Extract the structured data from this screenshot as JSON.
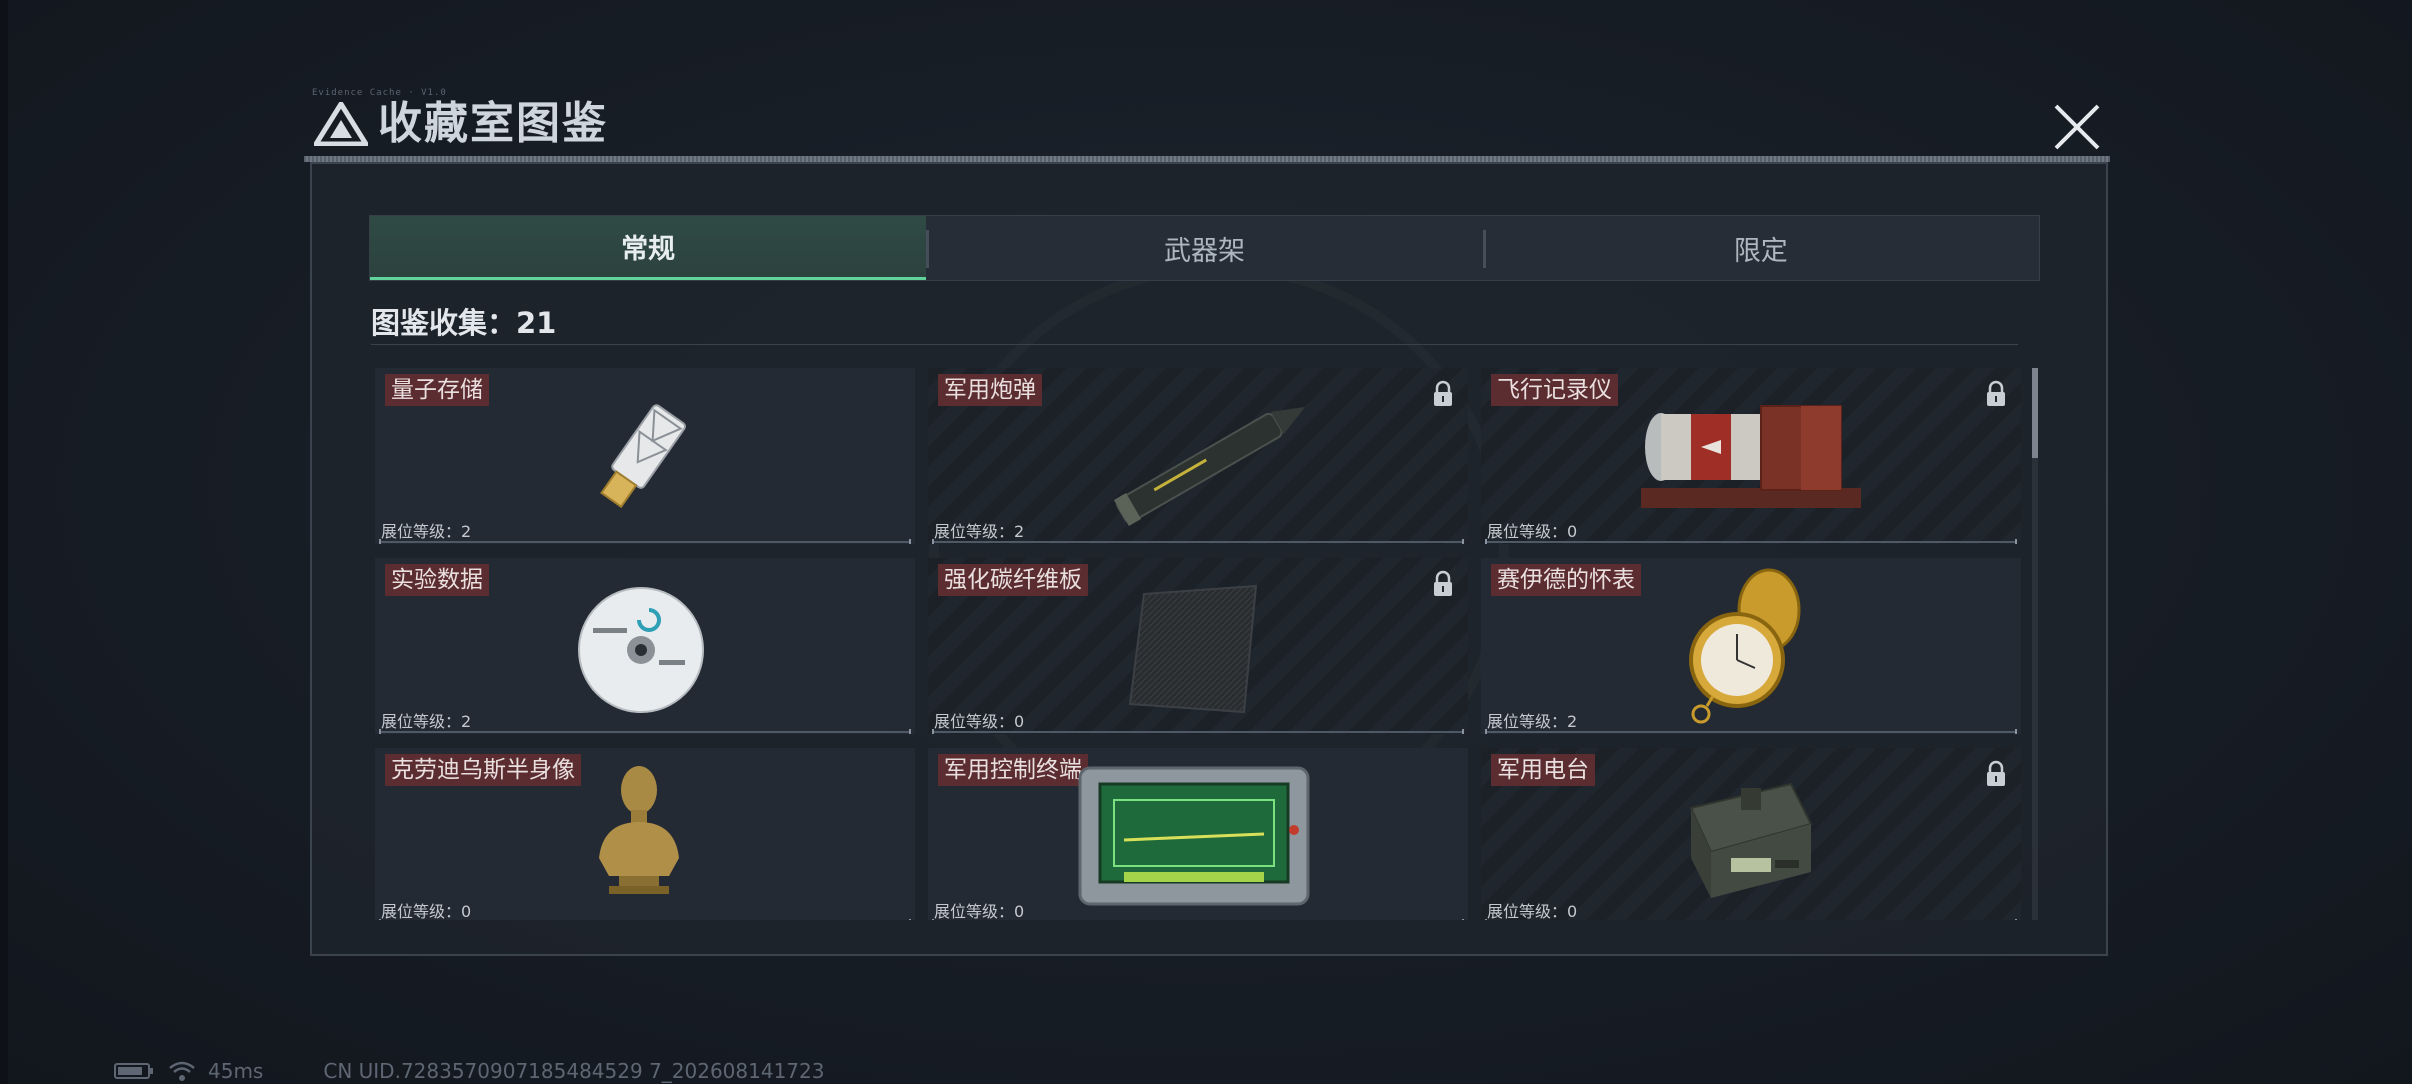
{
  "header": {
    "tiny_text": "Evidence Cache · V1.0",
    "title": "收藏室图鉴",
    "close_icon": "close-icon",
    "logo_icon": "triangle-logo-icon"
  },
  "tabs": [
    {
      "label": "常规",
      "active": true
    },
    {
      "label": "武器架",
      "active": false
    },
    {
      "label": "限定",
      "active": false
    }
  ],
  "collection": {
    "text": "图鉴收集：21"
  },
  "level_prefix": "展位等级：",
  "items": [
    {
      "name": "量子存储",
      "level": "展位等级：2",
      "locked": false,
      "icon": "usb-drive-icon"
    },
    {
      "name": "军用炮弹",
      "level": "展位等级：2",
      "locked": true,
      "icon": "artillery-shell-icon"
    },
    {
      "name": "飞行记录仪",
      "level": "展位等级：0",
      "locked": true,
      "icon": "flight-recorder-icon"
    },
    {
      "name": "实验数据",
      "level": "展位等级：2",
      "locked": false,
      "icon": "disc-icon"
    },
    {
      "name": "强化碳纤维板",
      "level": "展位等级：0",
      "locked": true,
      "icon": "carbon-plate-icon"
    },
    {
      "name": "赛伊德的怀表",
      "level": "展位等级：2",
      "locked": false,
      "icon": "pocket-watch-icon"
    },
    {
      "name": "克劳迪乌斯半身像",
      "level": "展位等级：0",
      "locked": false,
      "icon": "bust-statue-icon"
    },
    {
      "name": "军用控制终端",
      "level": "展位等级：0",
      "locked": false,
      "icon": "control-terminal-icon"
    },
    {
      "name": "军用电台",
      "level": "展位等级：0",
      "locked": true,
      "icon": "military-radio-icon"
    }
  ],
  "footer": {
    "ping": "45ms",
    "uid": "CN UID.7283570907185484529 7_202608141723"
  },
  "colors": {
    "accent_green": "#5fd39a",
    "tag_red": "#5b2d30",
    "panel": "#1e242c"
  }
}
